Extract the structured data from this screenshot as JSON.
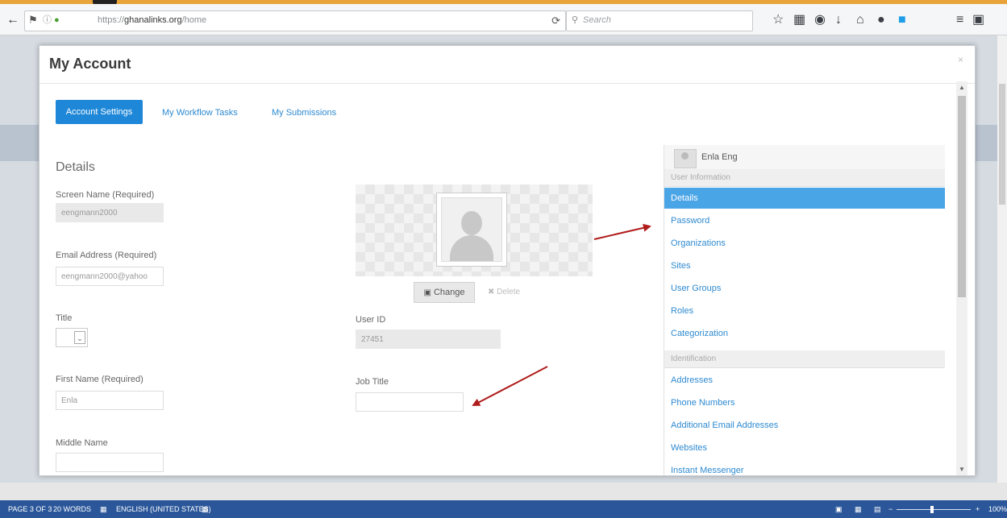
{
  "browser": {
    "url_prefix": "https://",
    "url_host": "ghanalinks.org",
    "url_path": "/home",
    "search_placeholder": "Search",
    "icons": [
      "back-icon",
      "firefox-icon",
      "info-icon",
      "lock-icon",
      "reload-icon",
      "search-icon",
      "bookmark-star-icon",
      "library-icon",
      "pocket-icon",
      "download-icon",
      "home-icon",
      "chat-icon",
      "skype-icon",
      "menu-icon",
      "extension-icon"
    ]
  },
  "modal": {
    "title": "My Account",
    "close": "×"
  },
  "tabs": [
    {
      "label": "Account Settings",
      "active": true
    },
    {
      "label": "My Workflow Tasks",
      "active": false
    },
    {
      "label": "My Submissions",
      "active": false
    }
  ],
  "details": {
    "section_title": "Details",
    "screen_name_label": "Screen Name (Required)",
    "screen_name_value": "eengmann2000",
    "email_label": "Email Address (Required)",
    "email_value": "eengmann2000@yahoo",
    "title_label": "Title",
    "first_name_label": "First Name (Required)",
    "first_name_value": "Enla",
    "middle_name_label": "Middle Name",
    "user_id_label": "User ID",
    "user_id_value": "27451",
    "job_title_label": "Job Title",
    "change_button": "Change",
    "delete_button": "Delete"
  },
  "sidebar": {
    "user_name": "Enla Eng",
    "group1": "User Information",
    "group1_items": [
      "Details",
      "Password",
      "Organizations",
      "Sites",
      "User Groups",
      "Roles",
      "Categorization"
    ],
    "group2": "Identification",
    "group2_items": [
      "Addresses",
      "Phone Numbers",
      "Additional Email Addresses",
      "Websites",
      "Instant Messenger"
    ]
  },
  "statusbar": {
    "page": "PAGE 3 OF 3",
    "words": "20 WORDS",
    "language": "ENGLISH (UNITED STATES)",
    "zoom": "100%"
  },
  "colors": {
    "accent": "#1e87d8",
    "link": "#2e8ad0",
    "active_item": "#4aa5e6",
    "arrow": "#b01c1c",
    "statusbar": "#2b579a"
  }
}
